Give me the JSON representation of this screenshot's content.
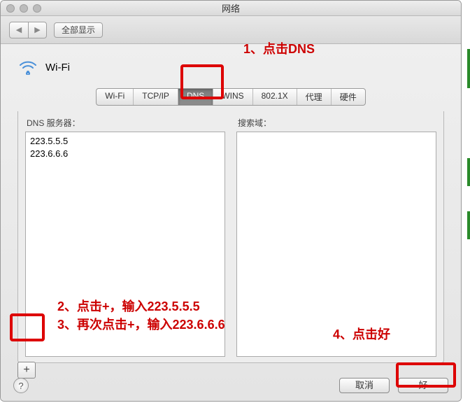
{
  "window": {
    "title": "网络"
  },
  "toolbar": {
    "back_label": "◀",
    "forward_label": "▶",
    "showall_label": "全部显示"
  },
  "header": {
    "wifi_label": "Wi-Fi"
  },
  "tabs": [
    {
      "label": "Wi-Fi"
    },
    {
      "label": "TCP/IP"
    },
    {
      "label": "DNS",
      "active": true
    },
    {
      "label": "WINS"
    },
    {
      "label": "802.1X"
    },
    {
      "label": "代理"
    },
    {
      "label": "硬件"
    }
  ],
  "dns": {
    "servers_label": "DNS 服务器：",
    "servers": [
      "223.5.5.5",
      "223.6.6.6"
    ],
    "search_label": "搜索域：",
    "search_domains": []
  },
  "buttons": {
    "add_label": "+",
    "cancel": "取消",
    "ok": "好",
    "help": "?"
  },
  "annotations": {
    "a1": "1、点击DNS",
    "a2": "2、点击+，输入223.5.5.5",
    "a3": "3、再次点击+，输入223.6.6.6",
    "a4": "4、点击好"
  }
}
